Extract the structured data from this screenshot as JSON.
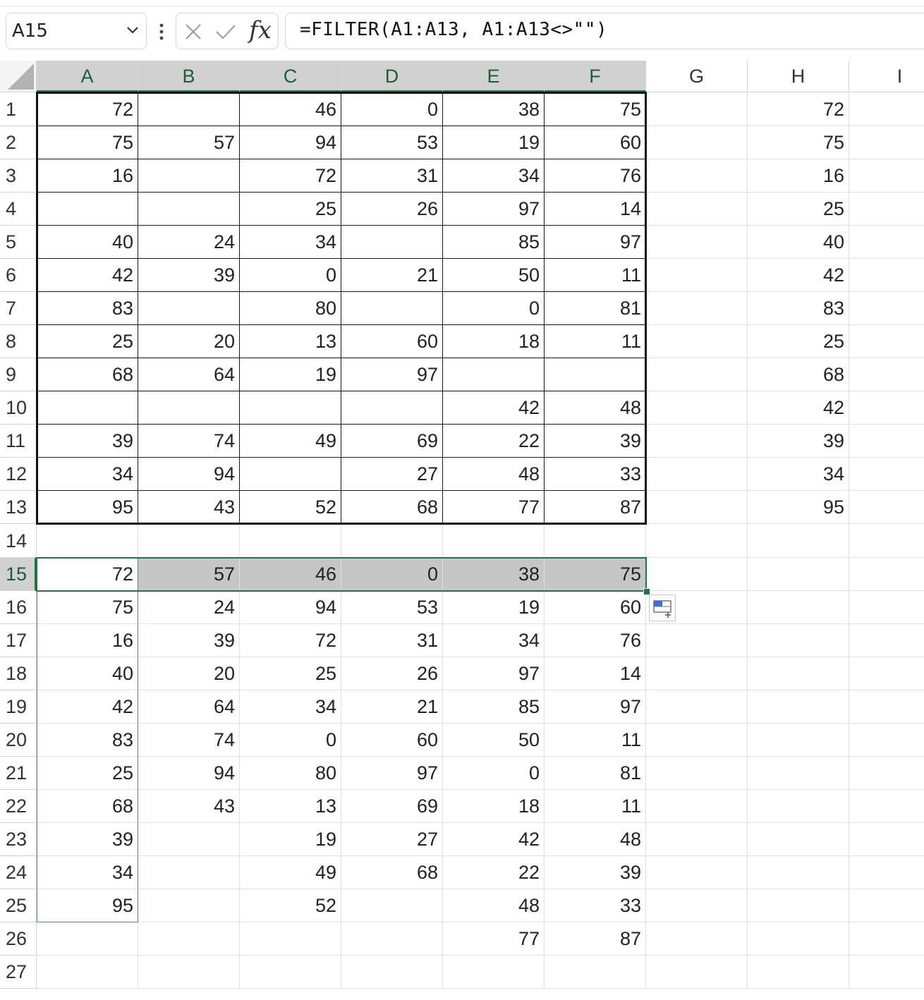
{
  "name_box": {
    "value": "A15"
  },
  "formula_bar": {
    "formula": "=FILTER(A1:A13, A1:A13<>\"\")"
  },
  "icons": {
    "name_box_dropdown": "chevron-down-icon",
    "more": "vertical-ellipsis-icon",
    "cancel": "x-icon",
    "enter": "checkmark-icon",
    "function": "fx-icon",
    "paste_options": "paste-options-icon"
  },
  "fx_label": "fx",
  "columns": [
    "A",
    "B",
    "C",
    "D",
    "E",
    "F",
    "G",
    "H",
    "I"
  ],
  "rows": [
    "1",
    "2",
    "3",
    "4",
    "5",
    "6",
    "7",
    "8",
    "9",
    "10",
    "11",
    "12",
    "13",
    "14",
    "15",
    "16",
    "17",
    "18",
    "19",
    "20",
    "21",
    "22",
    "23",
    "24",
    "25",
    "26",
    "27"
  ],
  "cells": {
    "A": [
      "72",
      "75",
      "16",
      "",
      "40",
      "42",
      "83",
      "25",
      "68",
      "",
      "39",
      "34",
      "95",
      "",
      "72",
      "75",
      "16",
      "40",
      "42",
      "83",
      "25",
      "68",
      "39",
      "34",
      "95",
      "",
      ""
    ],
    "B": [
      "",
      "57",
      "",
      "",
      "24",
      "39",
      "",
      "20",
      "64",
      "",
      "74",
      "94",
      "43",
      "",
      "57",
      "24",
      "39",
      "20",
      "64",
      "74",
      "94",
      "43",
      "",
      "",
      "",
      "",
      ""
    ],
    "C": [
      "46",
      "94",
      "72",
      "25",
      "34",
      "0",
      "80",
      "13",
      "19",
      "",
      "49",
      "",
      "52",
      "",
      "46",
      "94",
      "72",
      "25",
      "34",
      "0",
      "80",
      "13",
      "19",
      "49",
      "52",
      "",
      ""
    ],
    "D": [
      "0",
      "53",
      "31",
      "26",
      "",
      "21",
      "",
      "60",
      "97",
      "",
      "69",
      "27",
      "68",
      "",
      "0",
      "53",
      "31",
      "26",
      "21",
      "60",
      "97",
      "69",
      "27",
      "68",
      "",
      "",
      ""
    ],
    "E": [
      "38",
      "19",
      "34",
      "97",
      "85",
      "50",
      "0",
      "18",
      "",
      "42",
      "22",
      "48",
      "77",
      "",
      "38",
      "19",
      "34",
      "97",
      "85",
      "50",
      "0",
      "18",
      "42",
      "22",
      "48",
      "77",
      ""
    ],
    "F": [
      "75",
      "60",
      "76",
      "14",
      "97",
      "11",
      "81",
      "11",
      "",
      "48",
      "39",
      "33",
      "87",
      "",
      "75",
      "60",
      "76",
      "14",
      "97",
      "11",
      "81",
      "11",
      "48",
      "39",
      "33",
      "87",
      ""
    ],
    "G": [
      "",
      "",
      "",
      "",
      "",
      "",
      "",
      "",
      "",
      "",
      "",
      "",
      "",
      "",
      "",
      "",
      "",
      "",
      "",
      "",
      "",
      "",
      "",
      "",
      "",
      "",
      ""
    ],
    "H": [
      "72",
      "75",
      "16",
      "25",
      "40",
      "42",
      "83",
      "25",
      "68",
      "42",
      "39",
      "34",
      "95",
      "",
      "",
      "",
      "",
      "",
      "",
      "",
      "",
      "",
      "",
      "",
      "",
      "",
      ""
    ],
    "I": [
      "",
      "",
      "",
      "",
      "",
      "",
      "",
      "",
      "",
      "",
      "",
      "",
      "",
      "",
      "",
      "",
      "",
      "",
      "",
      "",
      "",
      "",
      "",
      "",
      "",
      "",
      ""
    ]
  },
  "colors": {
    "selection": "#217346",
    "header_selected_bg": "#d1d1d1",
    "spill_border": "#4f7fd0"
  }
}
